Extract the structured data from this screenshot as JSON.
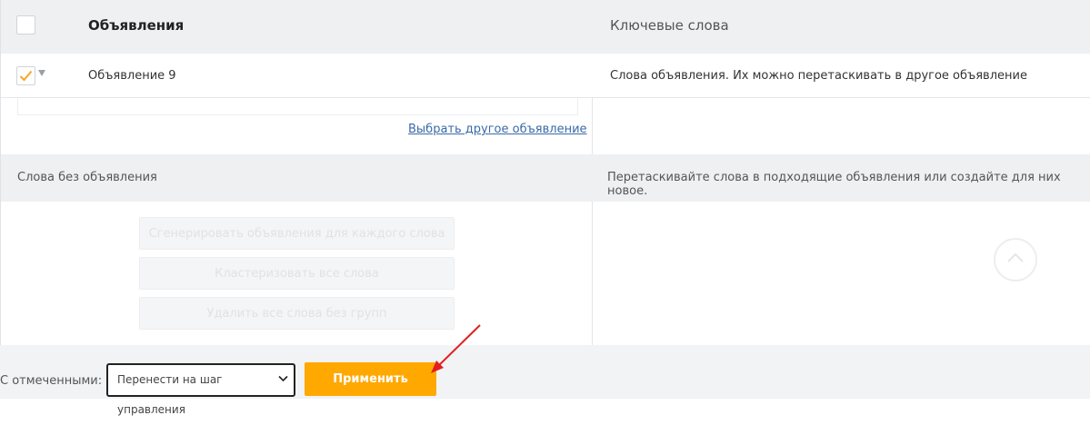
{
  "header": {
    "title": "Объявления",
    "keywords": "Ключевые слова"
  },
  "ad": {
    "name": "Объявление 9",
    "checked": true,
    "description": "Слова объявления. Их можно перетаскивать в другое объявление",
    "choose_other_link": "Выбрать другое объявление"
  },
  "no_ad_section": {
    "title": "Слова без объявления",
    "hint": "Перетаскивайте слова в подходящие объявления или создайте для них новое.",
    "actions": [
      "Сгенерировать объявления для каждого слова",
      "Кластеризовать все слова",
      "Удалить все слова без групп"
    ]
  },
  "footer": {
    "label": "С отмеченными:",
    "select_value": "Перенести на шаг управления",
    "apply_label": "Применить"
  },
  "colors": {
    "accent": "#ffa800",
    "checkmark": "#f5a623",
    "link": "#3a6aa8",
    "annotation_arrow": "#e02020"
  },
  "icons": {
    "checkmark": "check-icon",
    "caret": "caret-down-icon",
    "scroll_up": "chevron-up-icon",
    "select_chevron": "chevron-down-icon"
  }
}
